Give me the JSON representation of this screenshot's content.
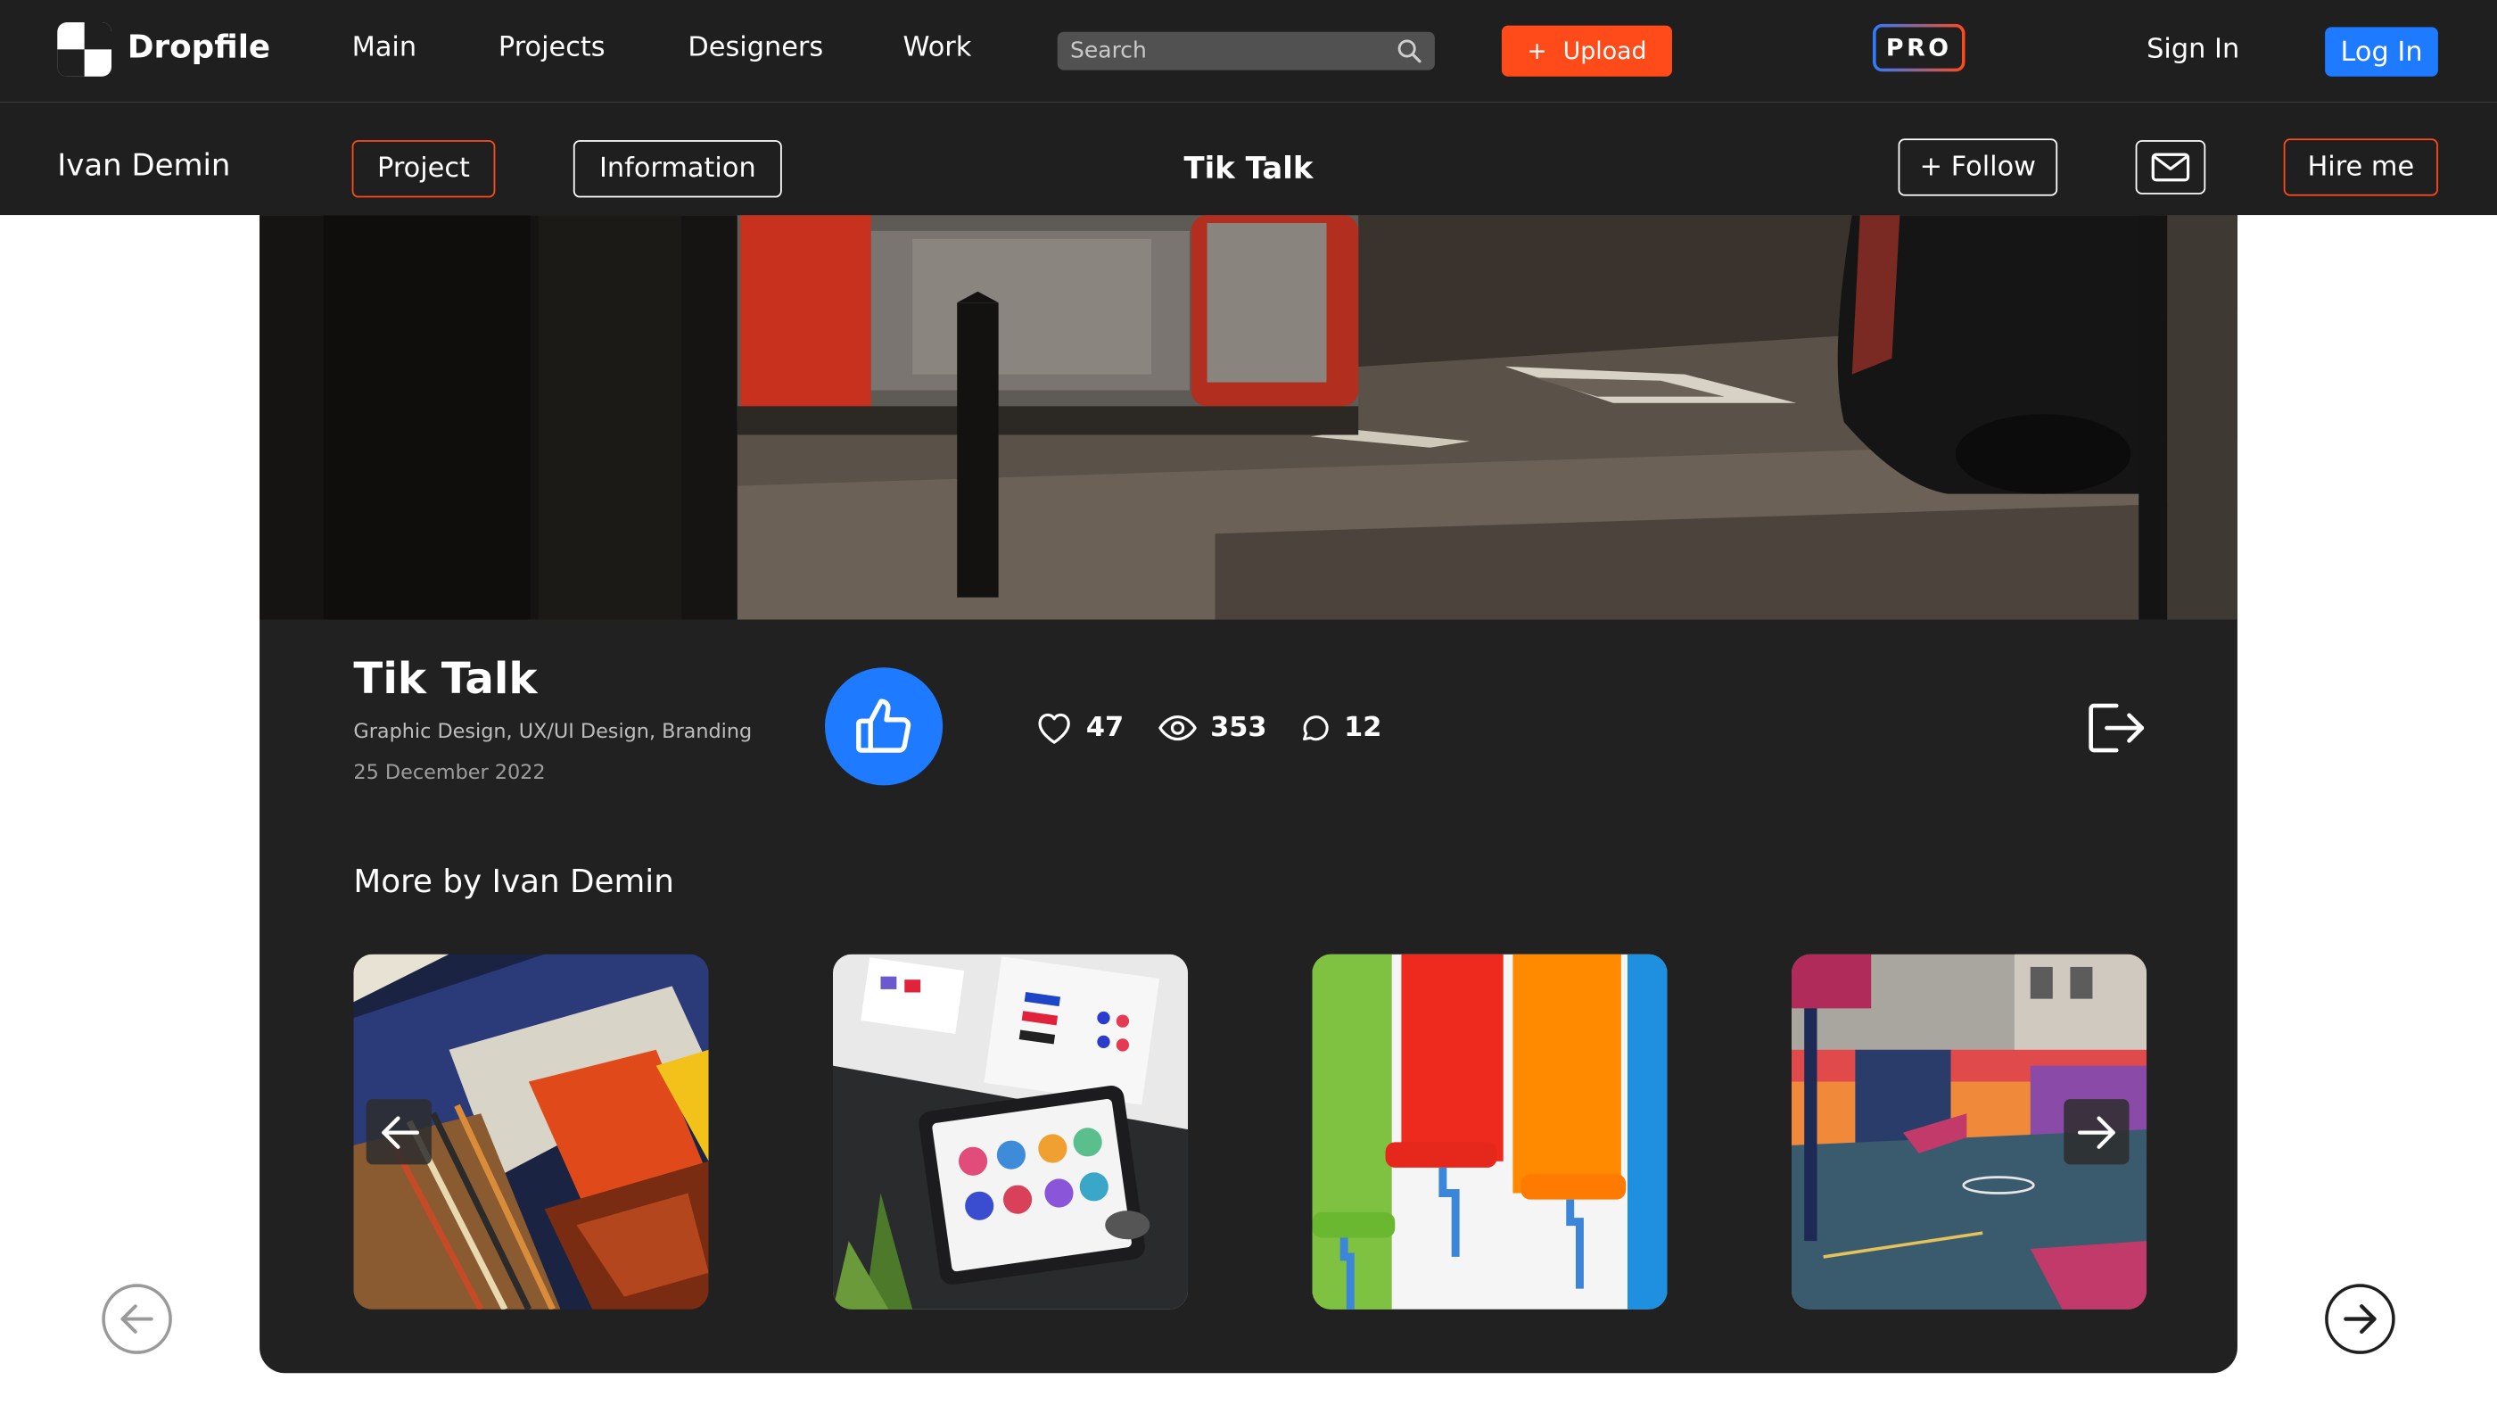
{
  "header": {
    "brand": "Dropfile",
    "nav": [
      "Main",
      "Projects",
      "Designers",
      "Work"
    ],
    "search_placeholder": "Search",
    "upload_icon": "+",
    "upload_label": "Upload",
    "pro_label": "PRO",
    "sign_in_label": "Sign In",
    "log_in_label": "Log In"
  },
  "subbar": {
    "author": "Ivan Demin",
    "project_tab": "Project",
    "information_tab": "Information",
    "title": "Tik Talk",
    "follow_label": "+ Follow",
    "hire_label": "Hire me"
  },
  "project": {
    "title": "Tik Talk",
    "tags": "Graphic Design, UX/UI Design, Branding",
    "date": "25 December 2022",
    "likes": "47",
    "views": "353",
    "comments": "12"
  },
  "more": {
    "title": "More by Ivan Demin"
  },
  "colors": {
    "accent_orange": "#ff4a1a",
    "accent_blue": "#1e7bff",
    "bar_bg": "#1f1f1f",
    "card_bg": "#212121"
  },
  "icons": {
    "search": "search-icon",
    "like": "thumbs-up-icon",
    "heart": "heart-icon",
    "eye": "eye-icon",
    "comment": "comment-icon",
    "share": "share-icon",
    "mail": "mail-icon",
    "prev": "arrow-left-icon",
    "next": "arrow-right-icon"
  }
}
